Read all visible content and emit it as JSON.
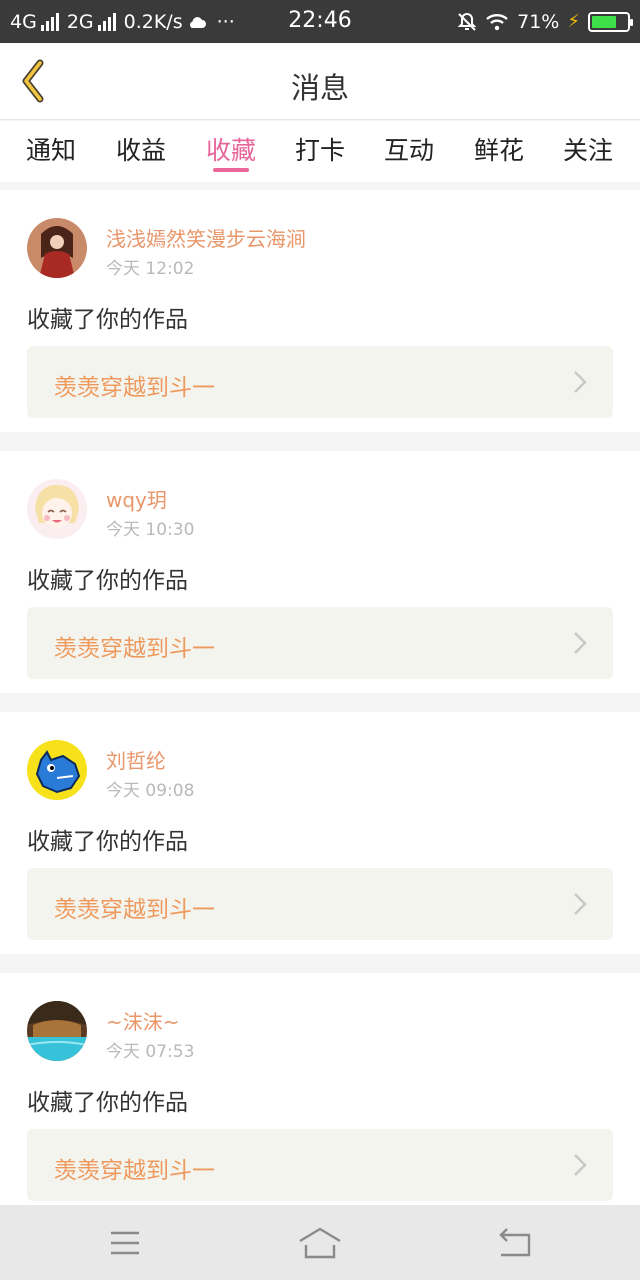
{
  "status_bar": {
    "net1": "4G",
    "net2": "2G",
    "speed": "0.2K/s",
    "dots": "···",
    "time": "22:46",
    "battery": "71%",
    "battery_level": 0.71
  },
  "header": {
    "title": "消息"
  },
  "tabs": [
    {
      "label": "通知"
    },
    {
      "label": "收益"
    },
    {
      "label": "收藏",
      "active": true
    },
    {
      "label": "打卡"
    },
    {
      "label": "互动"
    },
    {
      "label": "鲜花"
    },
    {
      "label": "关注"
    }
  ],
  "messages": [
    {
      "username": "浅浅嫣然笑漫步云海涧",
      "time": "今天 12:02",
      "action": "收藏了你的作品",
      "work_title": "羡羡穿越到斗一"
    },
    {
      "username": "wqy玥",
      "time": "今天 10:30",
      "action": "收藏了你的作品",
      "work_title": "羡羡穿越到斗一"
    },
    {
      "username": "刘哲纶",
      "time": "今天 09:08",
      "action": "收藏了你的作品",
      "work_title": "羡羡穿越到斗一"
    },
    {
      "username": "~沫沫~",
      "time": "今天 07:53",
      "action": "收藏了你的作品",
      "work_title": "羡羡穿越到斗一"
    }
  ],
  "colors": {
    "accent": "#e8669a",
    "username": "#e8966a",
    "work_title": "#ee9a5e"
  },
  "icons": {
    "back": "back-chevron-icon",
    "menu": "menu-icon",
    "home": "home-icon",
    "return": "return-icon"
  }
}
